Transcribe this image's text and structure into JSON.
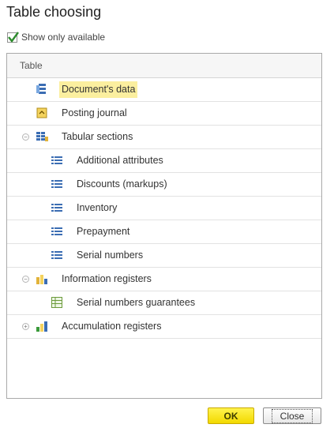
{
  "dialog": {
    "title": "Table choosing"
  },
  "filter": {
    "show_only_available_label": "Show only available",
    "show_only_available_checked": true
  },
  "table": {
    "header": "Table",
    "rows": [
      {
        "label": "Document's data",
        "level": 0,
        "icon": "document-data-icon",
        "selected": true
      },
      {
        "label": "Posting journal",
        "level": 0,
        "icon": "posting-journal-icon"
      },
      {
        "label": "Tabular sections",
        "level": 0,
        "icon": "tabular-sections-icon",
        "expanded": true
      },
      {
        "label": "Additional attributes",
        "level": 1,
        "icon": "table-icon"
      },
      {
        "label": "Discounts (markups)",
        "level": 1,
        "icon": "table-icon"
      },
      {
        "label": "Inventory",
        "level": 1,
        "icon": "table-icon"
      },
      {
        "label": "Prepayment",
        "level": 1,
        "icon": "table-icon"
      },
      {
        "label": "Serial numbers",
        "level": 1,
        "icon": "table-icon"
      },
      {
        "label": "Information registers",
        "level": 0,
        "icon": "information-registers-icon",
        "expanded": true
      },
      {
        "label": "Serial numbers guarantees",
        "level": 1,
        "icon": "information-register-icon"
      },
      {
        "label": "Accumulation registers",
        "level": 0,
        "icon": "accumulation-registers-icon",
        "expanded": false
      }
    ]
  },
  "buttons": {
    "ok_label": "OK",
    "close_label": "Close"
  },
  "colors": {
    "selection": "#fbef9f",
    "ok_button": "#fff34d",
    "checkmark": "#2e8b2e"
  }
}
